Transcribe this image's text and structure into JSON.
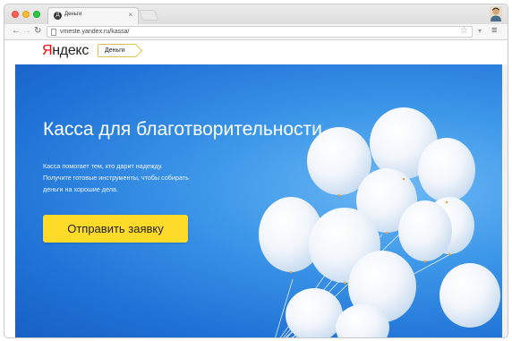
{
  "browser": {
    "tab_title": "Деньги",
    "tab_favicon": "Д",
    "url": "vmeste.yandex.ru/kassa/"
  },
  "icons": {
    "back": "back-arrow-icon",
    "forward": "forward-arrow-icon",
    "reload": "reload-icon",
    "bookmark": "star-icon",
    "menu": "hamburger-menu-icon",
    "close": "close-icon",
    "user": "user-avatar-icon"
  },
  "header": {
    "logo_first": "Я",
    "logo_rest": "ндекс",
    "service_badge": "Деньги"
  },
  "hero": {
    "title": "Касса для благотворительности",
    "description_lines": [
      "Касса помогает тем, кто дарит надежду.",
      "Получите готовые инструменты, чтобы собирать",
      "деньги на хорошие дела."
    ],
    "cta_label": "Отправить заявку"
  },
  "colors": {
    "hero_blue": "#1f72d6",
    "cta_yellow": "#ffdb29",
    "logo_red": "#ff0000",
    "badge_border": "#d8c44f"
  }
}
